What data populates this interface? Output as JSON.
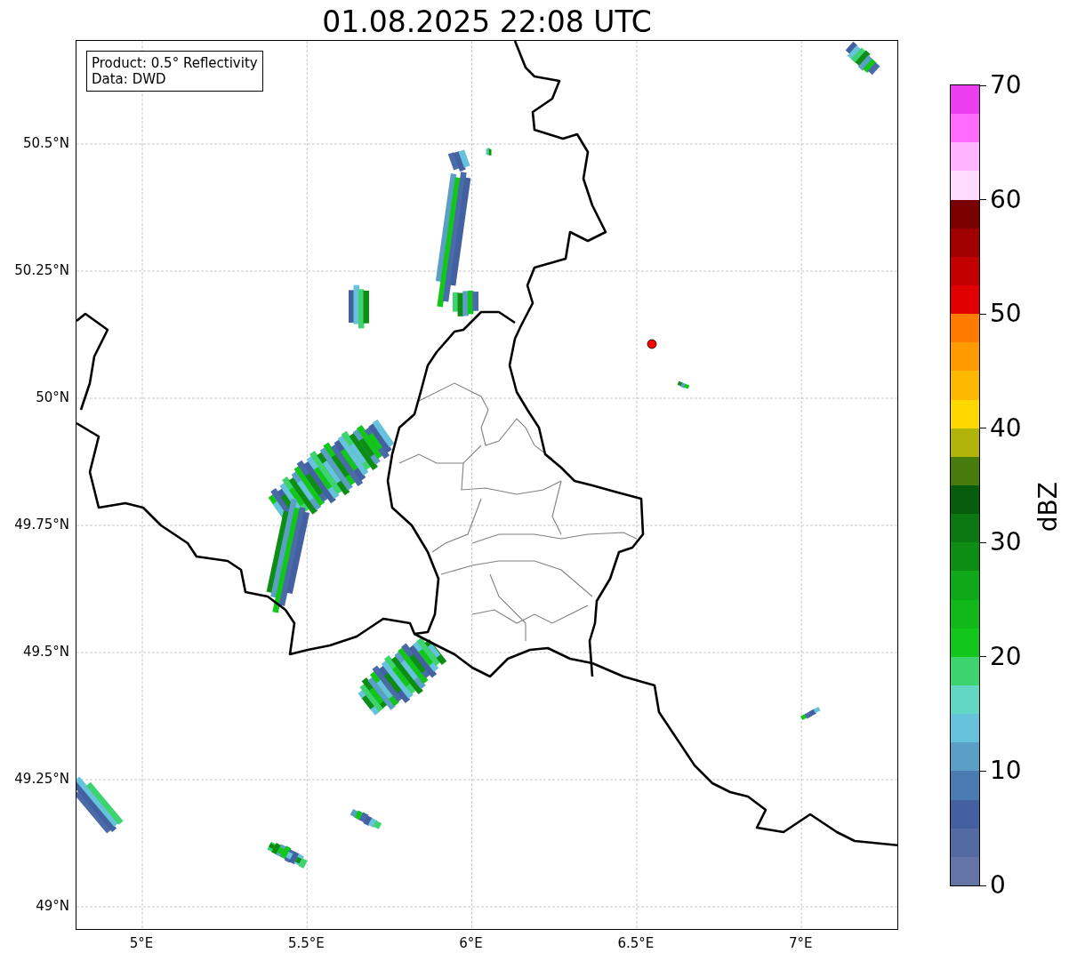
{
  "title": "01.08.2025 22:08 UTC",
  "info_box": [
    "Product: 0.5° Reflectivity",
    "Data: DWD"
  ],
  "y_ticks": [
    "50.5°N",
    "50.25°N",
    "50°N",
    "49.75°N",
    "49.5°N",
    "49.25°N",
    "49°N"
  ],
  "x_ticks": [
    "5°E",
    "5.5°E",
    "6°E",
    "6.5°E",
    "7°E"
  ],
  "colorbar": {
    "label": "dBZ",
    "ticks": [
      "70",
      "60",
      "50",
      "40",
      "30",
      "20",
      "10",
      "0"
    ],
    "bands": [
      {
        "color": "#ea3ef0"
      },
      {
        "color": "#ff6bff"
      },
      {
        "color": "#ffb4ff"
      },
      {
        "color": "#ffdcff"
      },
      {
        "color": "#7a0000"
      },
      {
        "color": "#a00000"
      },
      {
        "color": "#c20000"
      },
      {
        "color": "#e00000"
      },
      {
        "color": "#ff7c00"
      },
      {
        "color": "#ff9a00"
      },
      {
        "color": "#ffb800"
      },
      {
        "color": "#ffd800"
      },
      {
        "color": "#b0b40a"
      },
      {
        "color": "#477b0c"
      },
      {
        "color": "#085c0e"
      },
      {
        "color": "#0b7812"
      },
      {
        "color": "#0d8d14"
      },
      {
        "color": "#0fa818"
      },
      {
        "color": "#10b81a"
      },
      {
        "color": "#12c71a"
      },
      {
        "color": "#3dd46f"
      },
      {
        "color": "#62d8c4"
      },
      {
        "color": "#67c3dc"
      },
      {
        "color": "#5b9fc6"
      },
      {
        "color": "#4a7bb3"
      },
      {
        "color": "#4360a0"
      },
      {
        "color": "#536aa2"
      },
      {
        "color": "#6474a6"
      }
    ]
  }
}
